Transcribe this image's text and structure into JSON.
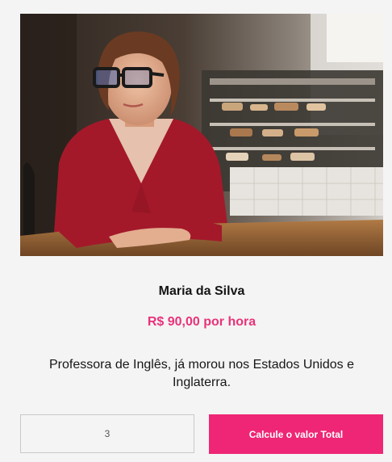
{
  "teacher": {
    "photo_subject": "woman-with-glasses-at-cafe-table",
    "name": "Maria da Silva",
    "price": "R$ 90,00 por hora",
    "description": "Professora de Inglês, já morou nos Estados Unidos e Inglaterra."
  },
  "calculator": {
    "quantity_value": "3",
    "button_label": "Calcule o valor Total"
  },
  "colors": {
    "accent": "#ee2675",
    "price_text": "#e8337a",
    "background": "#f4f4f4"
  }
}
